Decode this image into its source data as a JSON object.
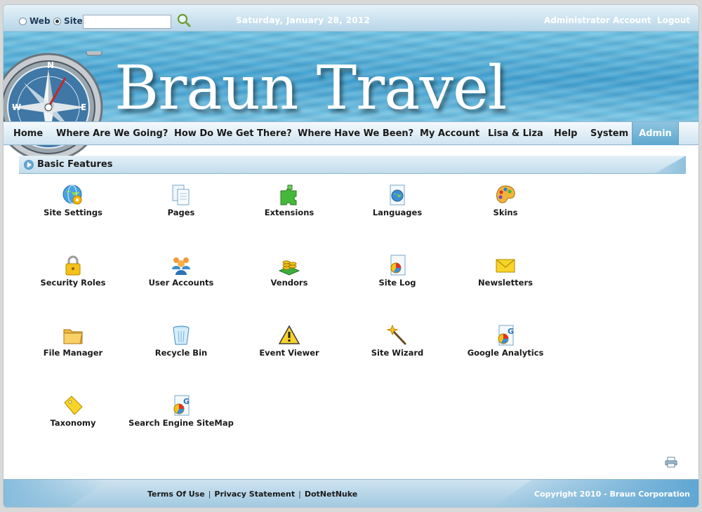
{
  "search": {
    "option_web": "Web",
    "option_site": "Site",
    "selected": "Site",
    "placeholder": ""
  },
  "header": {
    "date": "Saturday, January 28, 2012",
    "account_link": "Administrator Account",
    "logout_link": "Logout"
  },
  "banner": {
    "title": "Braun Travel"
  },
  "nav": {
    "items": [
      {
        "label": "Home"
      },
      {
        "label": "Where Are We Going?"
      },
      {
        "label": "How Do We Get There?"
      },
      {
        "label": "Where Have We Been?"
      },
      {
        "label": "My Account"
      },
      {
        "label": "Lisa & Liza"
      },
      {
        "label": "Help"
      },
      {
        "label": "System"
      },
      {
        "label": "Admin",
        "active": true
      }
    ]
  },
  "section": {
    "title": "Basic Features"
  },
  "features": [
    {
      "label": "Site Settings",
      "icon": "globe-gear-icon"
    },
    {
      "label": "Pages",
      "icon": "pages-icon"
    },
    {
      "label": "Extensions",
      "icon": "puzzle-icon"
    },
    {
      "label": "Languages",
      "icon": "languages-icon"
    },
    {
      "label": "Skins",
      "icon": "palette-icon"
    },
    {
      "label": "Security Roles",
      "icon": "padlock-icon"
    },
    {
      "label": "User Accounts",
      "icon": "users-icon"
    },
    {
      "label": "Vendors",
      "icon": "coins-icon"
    },
    {
      "label": "Site Log",
      "icon": "site-log-icon"
    },
    {
      "label": "Newsletters",
      "icon": "envelope-icon"
    },
    {
      "label": "File Manager",
      "icon": "folder-icon"
    },
    {
      "label": "Recycle Bin",
      "icon": "recycle-bin-icon"
    },
    {
      "label": "Event Viewer",
      "icon": "warning-icon"
    },
    {
      "label": "Site Wizard",
      "icon": "magic-wand-icon"
    },
    {
      "label": "Google Analytics",
      "icon": "analytics-icon"
    },
    {
      "label": "Taxonomy",
      "icon": "tag-icon"
    },
    {
      "label": "Search Engine SiteMap",
      "icon": "sitemap-icon"
    }
  ],
  "footer": {
    "terms": "Terms Of Use",
    "privacy": "Privacy Statement",
    "dnn": "DotNetNuke",
    "copyright": "Copyright 2010 - Braun Corporation"
  },
  "colors": {
    "accent": "#5ea8cf",
    "banner_water": "#3d9fcf",
    "nav_active_text": "#ffffff"
  }
}
